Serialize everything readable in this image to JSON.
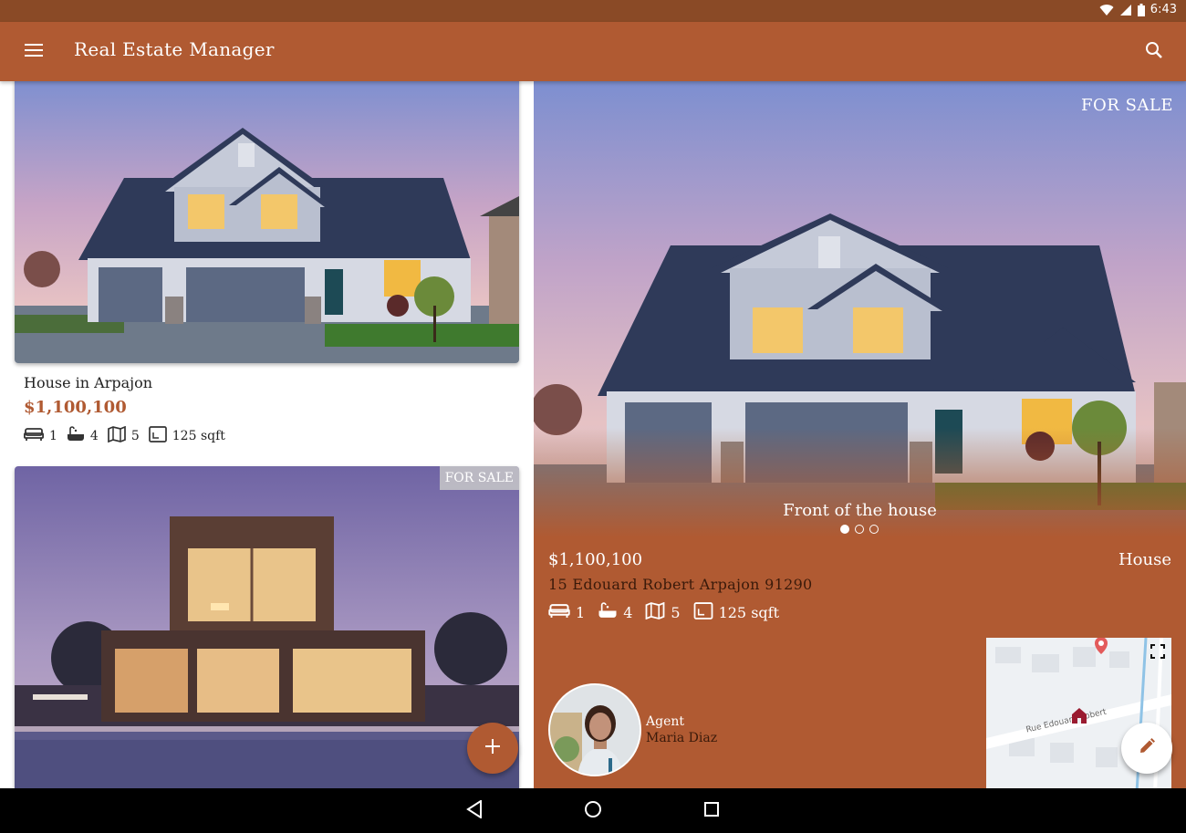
{
  "status_bar": {
    "time": "6:43"
  },
  "app_bar": {
    "title": "Real Estate Manager",
    "icons": {
      "menu": "menu-icon",
      "search": "search-icon"
    }
  },
  "colors": {
    "primary": "#b05a32",
    "primary_dark": "#8a4a26",
    "address_text": "#3a1a0a"
  },
  "list": {
    "cards": [
      {
        "title": "House in Arpajon",
        "price": "$1,100,100",
        "features": {
          "rooms": "1",
          "bathrooms": "4",
          "bedrooms": "5",
          "surface": "125 sqft"
        }
      },
      {
        "badge": "FOR SALE"
      }
    ],
    "fab_icon": "add-icon"
  },
  "detail": {
    "badge": "FOR SALE",
    "photo_caption": "Front of the house",
    "photo_count": 3,
    "active_photo": 1,
    "price": "$1,100,100",
    "type": "House",
    "address": "15 Edouard Robert Arpajon 91290",
    "features": {
      "rooms": "1",
      "bathrooms": "4",
      "bedrooms": "5",
      "surface": "125 sqft"
    },
    "agent_label": "Agent",
    "agent_name": "Maria Diaz",
    "map": {
      "street": "Rue Edouard Robert"
    },
    "edit_icon": "pencil-icon"
  },
  "nav_bar": {
    "icons": [
      "back-icon",
      "home-icon",
      "recents-icon"
    ]
  }
}
